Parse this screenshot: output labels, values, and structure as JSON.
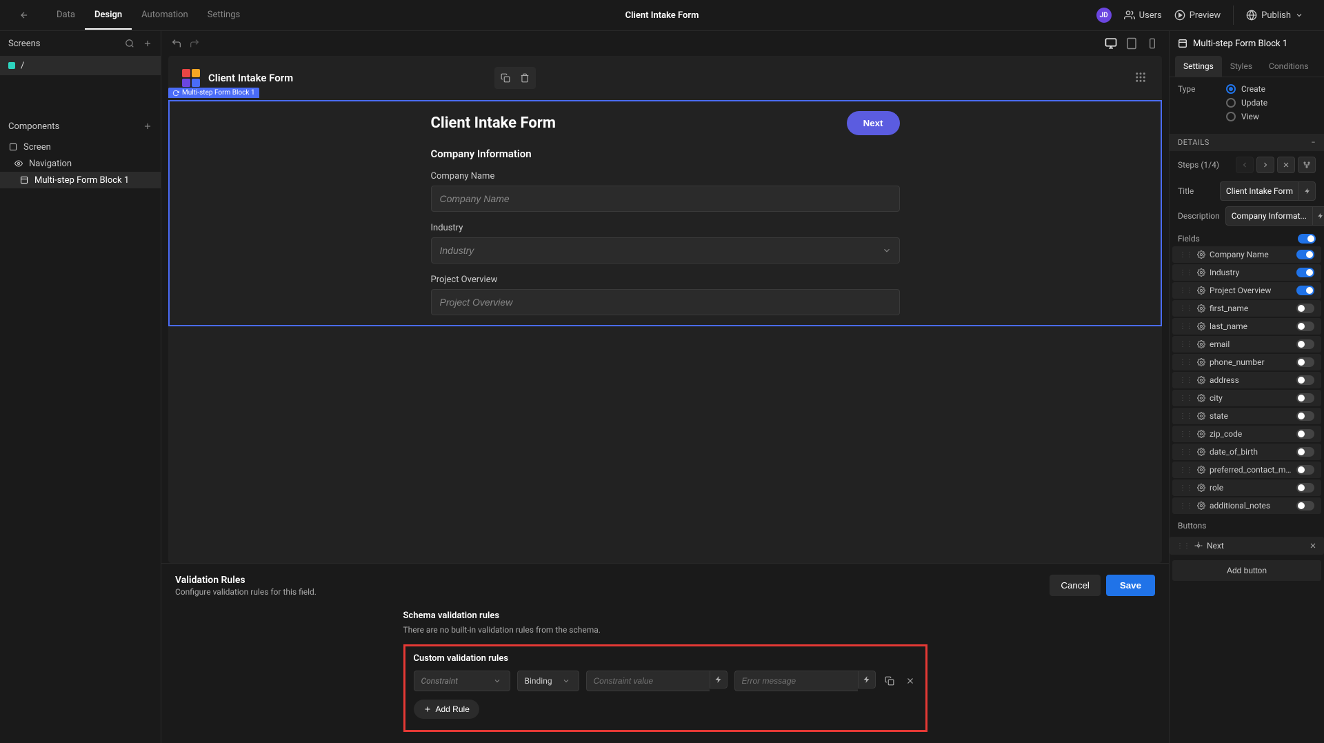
{
  "topBar": {
    "tabs": [
      "Data",
      "Design",
      "Automation",
      "Settings"
    ],
    "activeTab": "Design",
    "title": "Client Intake Form",
    "avatar": "JD",
    "users": "Users",
    "preview": "Preview",
    "publish": "Publish"
  },
  "leftPanel": {
    "screensLabel": "Screens",
    "screenName": "/",
    "componentsLabel": "Components",
    "items": [
      {
        "label": "Screen",
        "selected": false,
        "icon": "square"
      },
      {
        "label": "Navigation",
        "selected": false,
        "icon": "eye"
      },
      {
        "label": "Multi-step Form Block 1",
        "selected": true,
        "icon": "form"
      }
    ]
  },
  "canvas": {
    "appTitle": "Client Intake Form",
    "blockLabel": "Multi-step Form Block 1",
    "formTitle": "Client Intake Form",
    "nextBtn": "Next",
    "sectionTitle": "Company Information",
    "fields": [
      {
        "label": "Company Name",
        "placeholder": "Company Name",
        "type": "text"
      },
      {
        "label": "Industry",
        "placeholder": "Industry",
        "type": "select"
      },
      {
        "label": "Project Overview",
        "placeholder": "Project Overview",
        "type": "text"
      }
    ]
  },
  "validation": {
    "title": "Validation Rules",
    "subtitle": "Configure validation rules for this field.",
    "cancel": "Cancel",
    "save": "Save",
    "schemaTitle": "Schema validation rules",
    "schemaEmpty": "There are no built-in validation rules from the schema.",
    "customTitle": "Custom validation rules",
    "constraintPlaceholder": "Constraint",
    "bindingLabel": "Binding",
    "constraintValuePlaceholder": "Constraint value",
    "errorMessagePlaceholder": "Error message",
    "addRule": "Add Rule"
  },
  "rightPanel": {
    "header": "Multi-step Form Block 1",
    "tabs": [
      "Settings",
      "Styles",
      "Conditions"
    ],
    "activeTab": "Settings",
    "typeLabel": "Type",
    "typeOptions": [
      "Create",
      "Update",
      "View"
    ],
    "typeSelected": "Create",
    "detailsLabel": "DETAILS",
    "stepsLabel": "Steps (1/4)",
    "titleLabel": "Title",
    "titleValue": "Client Intake Form",
    "descLabel": "Description",
    "descValue": "Company Informat...",
    "fieldsLabel": "Fields",
    "fields": [
      {
        "name": "Company Name",
        "on": true
      },
      {
        "name": "Industry",
        "on": true
      },
      {
        "name": "Project Overview",
        "on": true
      },
      {
        "name": "first_name",
        "on": false
      },
      {
        "name": "last_name",
        "on": false
      },
      {
        "name": "email",
        "on": false
      },
      {
        "name": "phone_number",
        "on": false
      },
      {
        "name": "address",
        "on": false
      },
      {
        "name": "city",
        "on": false
      },
      {
        "name": "state",
        "on": false
      },
      {
        "name": "zip_code",
        "on": false
      },
      {
        "name": "date_of_birth",
        "on": false
      },
      {
        "name": "preferred_contact_method",
        "on": false
      },
      {
        "name": "role",
        "on": false
      },
      {
        "name": "additional_notes",
        "on": false
      }
    ],
    "buttonsLabel": "Buttons",
    "buttons": [
      {
        "name": "Next"
      }
    ],
    "addButton": "Add button"
  }
}
